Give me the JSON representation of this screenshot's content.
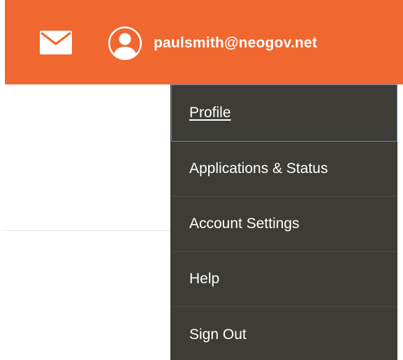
{
  "header": {
    "background_color": "#f0682f",
    "mail_icon": "envelope-icon",
    "user_icon": "user-circle-icon",
    "user_email": "paulsmith@neogov.net"
  },
  "account_menu": {
    "background_color": "#3d3c37",
    "focus_color": "#5b84c4",
    "items": [
      {
        "label": "Profile",
        "focused": true
      },
      {
        "label": "Applications & Status"
      },
      {
        "label": "Account Settings"
      },
      {
        "label": "Help"
      },
      {
        "label": "Sign Out"
      }
    ]
  }
}
